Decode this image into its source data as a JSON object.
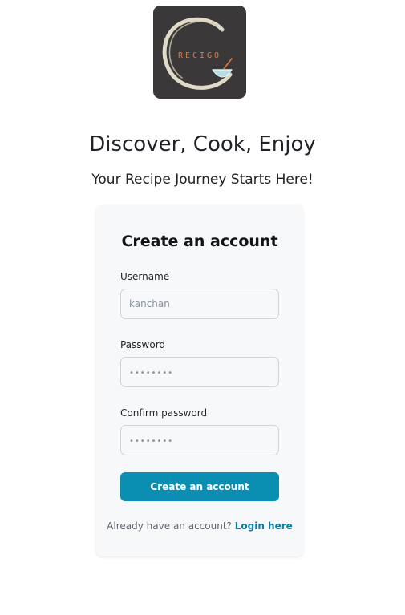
{
  "logo": {
    "text": "RECIGO",
    "background": "#3a3838",
    "accent": "#e07a3c"
  },
  "hero": {
    "headline": "Discover, Cook, Enjoy",
    "subline": "Your Recipe Journey Starts Here!"
  },
  "form": {
    "title": "Create an account",
    "username": {
      "label": "Username",
      "placeholder": "kanchan",
      "value": ""
    },
    "password": {
      "label": "Password",
      "placeholder": "••••••••",
      "value": ""
    },
    "confirm_password": {
      "label": "Confirm password",
      "placeholder": "••••••••",
      "value": ""
    },
    "submit_label": "Create an account",
    "login_prompt": "Already have an account?",
    "login_link": "Login here"
  },
  "colors": {
    "primary_button": "#0a8fb3",
    "link": "#0a7ea4",
    "card_background": "#f6f8fa"
  }
}
